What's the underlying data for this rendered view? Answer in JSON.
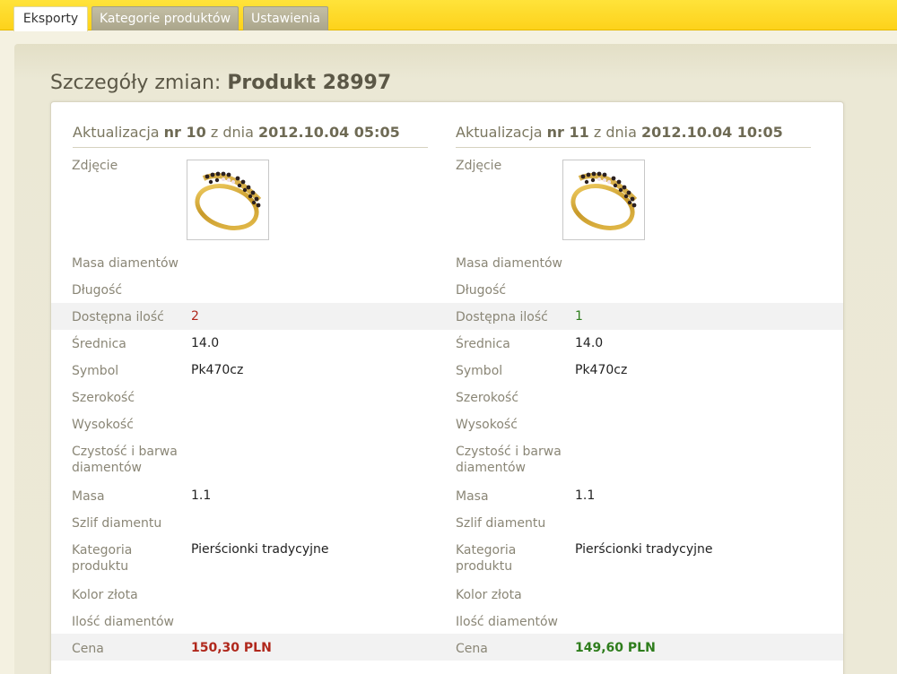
{
  "tabs": [
    {
      "label": "Eksporty",
      "active": true
    },
    {
      "label": "Kategorie produktów",
      "active": false
    },
    {
      "label": "Ustawienia",
      "active": false
    }
  ],
  "page": {
    "title_prefix": "Szczegóły zmian: ",
    "title_product": "Produkt 28997"
  },
  "columns": [
    {
      "header": {
        "prefix": "Aktualizacja ",
        "nr": "nr 10",
        "mid": " z dnia ",
        "date": "2012.10.04 05:05"
      },
      "image_icon": "ring-image",
      "rows": {
        "zdjecie": "Zdjęcie",
        "masa_diamentow": "Masa diamentów",
        "dlugosc": "Długość",
        "dostepna_ilosc": {
          "label": "Dostępna ilość",
          "value": "2"
        },
        "srednica": {
          "label": "Średnica",
          "value": "14.0"
        },
        "symbol": {
          "label": "Symbol",
          "value": "Pk470cz"
        },
        "szerokosc": "Szerokość",
        "wysokosc": "Wysokość",
        "czystosc_1": "Czystość i barwa",
        "czystosc_2": "diamentów",
        "masa": {
          "label": "Masa",
          "value": "1.1"
        },
        "szlif": "Szlif diamentu",
        "kategoria_1": "Kategoria",
        "kategoria_2": "produktu",
        "kategoria_value": "Pierścionki tradycyjne",
        "kolor_zlota": "Kolor złota",
        "ilosc_diamentow": "Ilość diamentów",
        "cena": {
          "label": "Cena",
          "value": "150,30 PLN"
        }
      }
    },
    {
      "header": {
        "prefix": "Aktualizacja ",
        "nr": "nr 11",
        "mid": " z dnia ",
        "date": "2012.10.04 10:05"
      },
      "image_icon": "ring-image",
      "rows": {
        "zdjecie": "Zdjęcie",
        "masa_diamentow": "Masa diamentów",
        "dlugosc": "Długość",
        "dostepna_ilosc": {
          "label": "Dostępna ilość",
          "value": "1"
        },
        "srednica": {
          "label": "Średnica",
          "value": "14.0"
        },
        "symbol": {
          "label": "Symbol",
          "value": "Pk470cz"
        },
        "szerokosc": "Szerokość",
        "wysokosc": "Wysokość",
        "czystosc_1": "Czystość i barwa",
        "czystosc_2": "diamentów",
        "masa": {
          "label": "Masa",
          "value": "1.1"
        },
        "szlif": "Szlif diamentu",
        "kategoria_1": "Kategoria",
        "kategoria_2": "produktu",
        "kategoria_value": "Pierścionki tradycyjne",
        "kolor_zlota": "Kolor złota",
        "ilosc_diamentow": "Ilość diamentów",
        "cena": {
          "label": "Cena",
          "value": "149,60 PLN"
        }
      }
    }
  ],
  "colors": {
    "topbar": "#fdd21b",
    "decrease": "#b0281c",
    "increase": "#2e7d1c",
    "label": "#8a8676"
  }
}
